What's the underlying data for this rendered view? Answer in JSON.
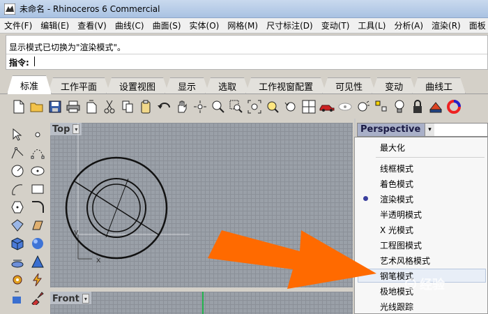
{
  "window": {
    "title": "未命名 - Rhinoceros 6 Commercial"
  },
  "menubar": {
    "items": [
      "文件(F)",
      "编辑(E)",
      "查看(V)",
      "曲线(C)",
      "曲面(S)",
      "实体(O)",
      "网格(M)",
      "尺寸标注(D)",
      "变动(T)",
      "工具(L)",
      "分析(A)",
      "渲染(R)",
      "面板"
    ]
  },
  "command": {
    "history": "显示模式已切换为\"渲染模式\"。",
    "prompt": "指令:",
    "input_value": ""
  },
  "tabs": [
    "标准",
    "工作平面",
    "设置视图",
    "显示",
    "选取",
    "工作视窗配置",
    "可见性",
    "变动",
    "曲线工"
  ],
  "toolbar": {
    "icons": [
      "new-file-icon",
      "open-folder-icon",
      "save-icon",
      "print-icon",
      "import-icon",
      "cut-icon",
      "copy-icon",
      "paste-icon",
      "undo-icon",
      "pan-hand-icon",
      "rotate-view-icon",
      "zoom-icon",
      "zoom-window-icon",
      "zoom-extents-icon",
      "zoom-selected-icon",
      "undo-view-icon",
      "four-viewports-icon",
      "car-icon",
      "hide-icon",
      "show-icon",
      "lock-icon",
      "light-bulb-icon",
      "padlock-icon",
      "material-icon",
      "color-wheel-icon"
    ]
  },
  "viewports": {
    "top": {
      "label": "Top",
      "axis_x": "x",
      "axis_y": "y"
    },
    "front": {
      "label": "Front"
    },
    "perspective": {
      "label": "Perspective"
    }
  },
  "display_menu": {
    "maximize": "最大化",
    "modes": [
      "线框模式",
      "着色模式",
      "渲染模式",
      "半透明模式",
      "X 光模式",
      "工程图模式",
      "艺术风格模式",
      "钢笔模式",
      "极地模式",
      "光线跟踪"
    ],
    "selected_mode": "渲染模式"
  },
  "colors": {
    "arrow": "#ff6a00",
    "viewport_bg": "#9aa0a8",
    "menu_radio": "#3a3f9e"
  },
  "watermark": {
    "text": "经验"
  }
}
